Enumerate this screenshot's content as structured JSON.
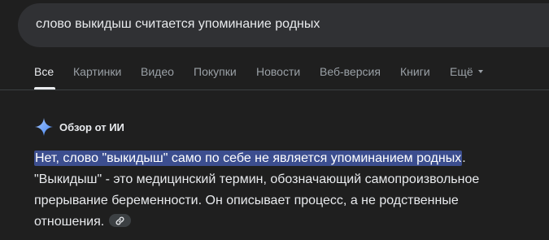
{
  "search": {
    "query": "слово выкидыш считается упоминание родных"
  },
  "tabs": [
    {
      "label": "Все",
      "active": true
    },
    {
      "label": "Картинки"
    },
    {
      "label": "Видео"
    },
    {
      "label": "Покупки"
    },
    {
      "label": "Новости"
    },
    {
      "label": "Веб-версия"
    },
    {
      "label": "Книги"
    },
    {
      "label": "Ещё",
      "icon": "chevron-down-icon"
    }
  ],
  "ai_overview": {
    "title": "Обзор от ИИ",
    "icon": "sparkle-icon",
    "highlighted_sentence": "Нет, слово \"выкидыш\" само по себе не является упоминанием родных",
    "highlight_period": ".",
    "line2": "\"Выкидыш\" - это медицинский термин, обозначающий самопроизвольное",
    "line3": "прерывание беременности. Он описывает процесс, а не родственные",
    "line4": "отношения.",
    "link_icon": "link-icon"
  },
  "colors": {
    "background": "#1f1f1f",
    "search_bar": "#303134",
    "highlight": "#3c4e8f",
    "text_primary": "#e8eaed",
    "text_secondary": "#9aa0a6",
    "sparkle_gradient": [
      "#4285f4",
      "#a8c7fa"
    ]
  }
}
